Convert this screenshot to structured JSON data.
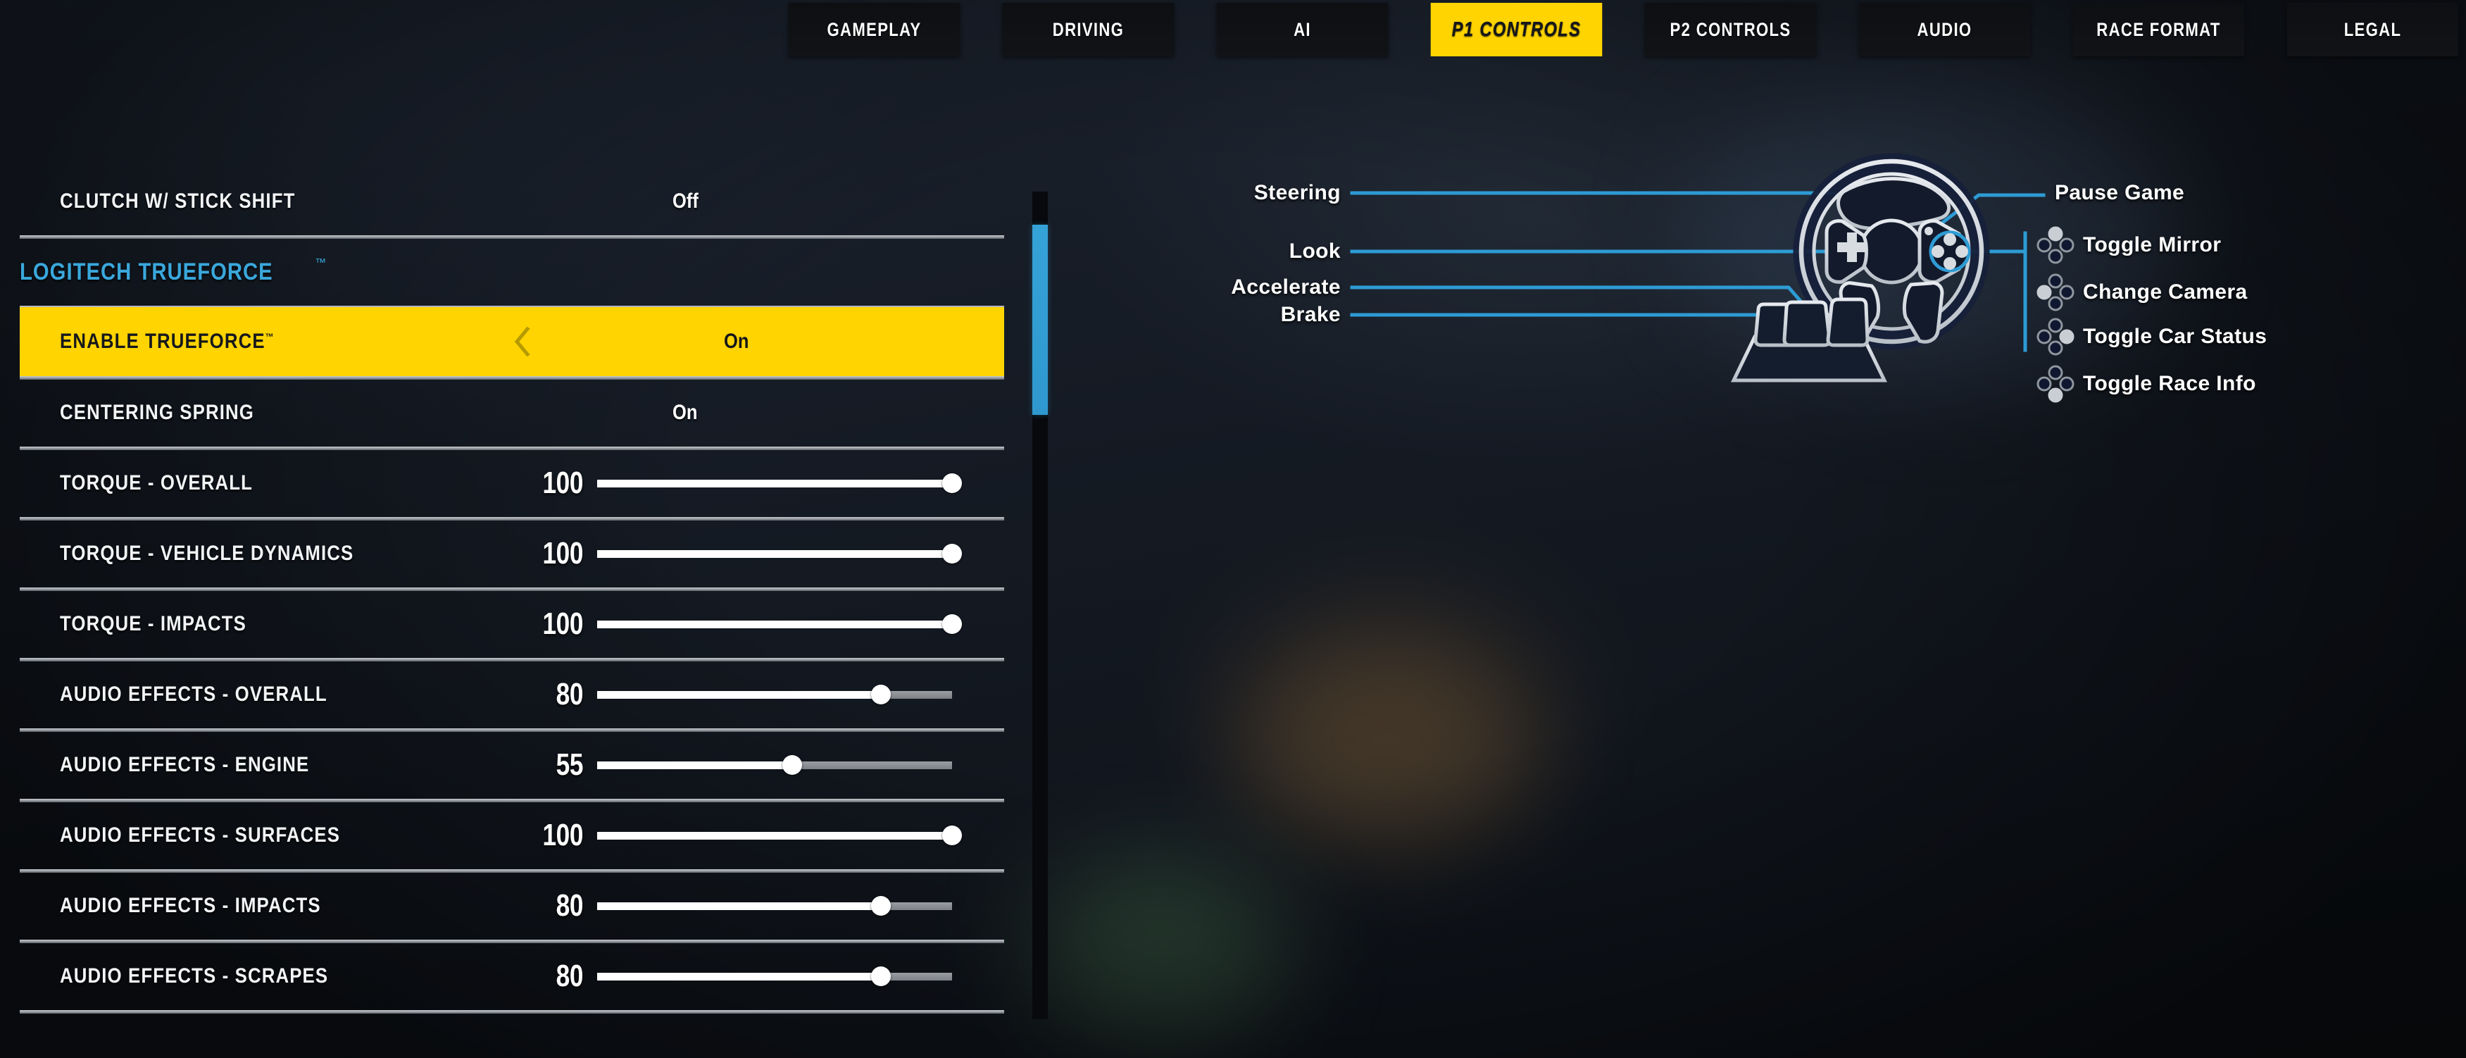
{
  "tabs": [
    {
      "label": "GAMEPLAY",
      "active": false
    },
    {
      "label": "DRIVING",
      "active": false
    },
    {
      "label": "AI",
      "active": false
    },
    {
      "label": "P1 CONTROLS",
      "active": true
    },
    {
      "label": "P2 CONTROLS",
      "active": false
    },
    {
      "label": "AUDIO",
      "active": false
    },
    {
      "label": "RACE FORMAT",
      "active": false
    },
    {
      "label": "LEGAL",
      "active": false
    }
  ],
  "colors": {
    "accent_yellow": "#ffd400",
    "accent_blue": "#3aa8dc",
    "scroll_thumb": "#32a0d7",
    "text_white": "#f2f4f6",
    "divider": "#9ba0a6",
    "wheel_outline": "#d8dde2",
    "wheel_fill": "#141d2e"
  },
  "settings_panel": {
    "rows": [
      {
        "type": "toggle",
        "label": "CLUTCH W/ STICK SHIFT",
        "value": "Off",
        "highlight": false,
        "tm": false,
        "chevron": false
      },
      {
        "type": "section",
        "label": "LOGITECH TRUEFORCE",
        "tm": true
      },
      {
        "type": "toggle",
        "label": "ENABLE TRUEFORCE",
        "value": "On",
        "highlight": true,
        "tm": true,
        "chevron": true
      },
      {
        "type": "toggle",
        "label": "CENTERING SPRING",
        "value": "On",
        "highlight": false,
        "tm": false,
        "chevron": false
      },
      {
        "type": "slider",
        "label": "TORQUE - OVERALL",
        "value": 100,
        "max": 100
      },
      {
        "type": "slider",
        "label": "TORQUE - VEHICLE DYNAMICS",
        "value": 100,
        "max": 100
      },
      {
        "type": "slider",
        "label": "TORQUE - IMPACTS",
        "value": 100,
        "max": 100
      },
      {
        "type": "slider",
        "label": "AUDIO EFFECTS - OVERALL",
        "value": 80,
        "max": 100
      },
      {
        "type": "slider",
        "label": "AUDIO EFFECTS - ENGINE",
        "value": 55,
        "max": 100
      },
      {
        "type": "slider",
        "label": "AUDIO EFFECTS - SURFACES",
        "value": 100,
        "max": 100
      },
      {
        "type": "slider",
        "label": "AUDIO EFFECTS - IMPACTS",
        "value": 80,
        "max": 100
      },
      {
        "type": "slider",
        "label": "AUDIO EFFECTS - SCRAPES",
        "value": 80,
        "max": 100
      }
    ],
    "scrollbar": {
      "thumb_top_pct": 4,
      "thumb_height_pct": 23
    }
  },
  "diagram": {
    "left_callouts": [
      {
        "label": "Steering"
      },
      {
        "label": "Look"
      },
      {
        "label": "Accelerate"
      },
      {
        "label": "Brake"
      }
    ],
    "right_callouts": [
      {
        "label": "Pause Game",
        "icon": "none"
      }
    ],
    "dpad_callouts": [
      {
        "label": "Toggle Mirror",
        "icon": "dpad-up-icon",
        "direction": "up"
      },
      {
        "label": "Change Camera",
        "icon": "dpad-left-icon",
        "direction": "left"
      },
      {
        "label": "Toggle Car Status",
        "icon": "dpad-right-icon",
        "direction": "right"
      },
      {
        "label": "Toggle Race Info",
        "icon": "dpad-down-icon",
        "direction": "down"
      }
    ]
  }
}
